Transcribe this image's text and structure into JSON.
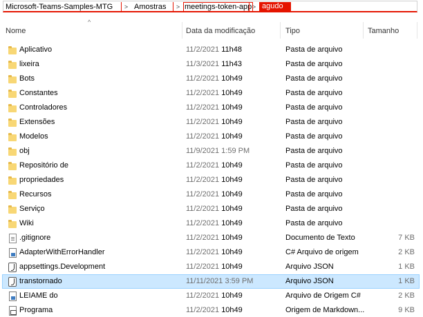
{
  "breadcrumb": {
    "items": [
      "Microsoft-Teams-Samples-MTG",
      "Amostras",
      "meetings-token-app"
    ],
    "active": "agudo",
    "separator": ">"
  },
  "columns": {
    "name": "Nome",
    "date": "Data da modificação",
    "type": "Tipo",
    "size": "Tamanho",
    "sort_indicator": "^"
  },
  "rows": [
    {
      "name": "Aplicativo",
      "date": "11/2/2021",
      "time": "11h48",
      "type": "Pasta de arquivo",
      "size": "",
      "icon": "folder-icon"
    },
    {
      "name": "lixeira",
      "date": "11/3/2021",
      "time": "11h43",
      "type": "Pasta de arquivo",
      "size": "",
      "icon": "folder-icon"
    },
    {
      "name": "Bots",
      "date": "11/2/2021",
      "time": "10h49",
      "type": "Pasta de arquivo",
      "size": "",
      "icon": "folder-icon"
    },
    {
      "name": "Constantes",
      "date": "11/2/2021",
      "time": "10h49",
      "type": "Pasta de arquivo",
      "size": "",
      "icon": "folder-icon"
    },
    {
      "name": "Controladores",
      "date": "11/2/2021",
      "time": "10h49",
      "type": "Pasta de arquivo",
      "size": "",
      "icon": "folder-icon"
    },
    {
      "name": "Extensões",
      "date": "11/2/2021",
      "time": "10h49",
      "type": "Pasta de arquivo",
      "size": "",
      "icon": "folder-icon"
    },
    {
      "name": "Modelos",
      "date": "11/2/2021",
      "time": "10h49",
      "type": "Pasta de arquivo",
      "size": "",
      "icon": "folder-icon"
    },
    {
      "name": "obj",
      "date": "11/9/2021 1:59 PM",
      "time": "",
      "type": "Pasta de arquivo",
      "size": "",
      "icon": "folder-icon"
    },
    {
      "name": "Repositório de",
      "date": "11/2/2021",
      "time": "10h49",
      "type": "Pasta de arquivo",
      "size": "",
      "icon": "folder-icon"
    },
    {
      "name": "propriedades",
      "date": "11/2/2021",
      "time": "10h49",
      "type": "Pasta de arquivo",
      "size": "",
      "icon": "folder-icon"
    },
    {
      "name": "Recursos",
      "date": "11/2/2021",
      "time": "10h49",
      "type": "Pasta de arquivo",
      "size": "",
      "icon": "folder-icon"
    },
    {
      "name": "Serviço",
      "date": "11/2/2021",
      "time": "10h49",
      "type": "Pasta de arquivo",
      "size": "",
      "icon": "folder-icon"
    },
    {
      "name": "Wiki",
      "date": "11/2/2021",
      "time": "10h49",
      "type": "Pasta de arquivo",
      "size": "",
      "icon": "folder-icon"
    },
    {
      "name": ".gitignore",
      "date": "11/2/2021",
      "time": "10h49",
      "type": "Documento de Texto",
      "size": "7 KB",
      "icon": "text-file-icon"
    },
    {
      "name": "AdapterWithErrorHandler",
      "date": "11/2/2021",
      "time": "10h49",
      "type": "C# Arquivo de origem",
      "size": "2 KB",
      "icon": "csharp-file-icon"
    },
    {
      "name": "appsettings.Development",
      "date": "11/2/2021",
      "time": "10h49",
      "type": "Arquivo JSON",
      "size": "1 KB",
      "icon": "json-file-icon"
    },
    {
      "name": "transtornado",
      "date": "11/11/2021 3:59 PM",
      "time": "",
      "type": "Arquivo JSON",
      "size": "1 KB",
      "icon": "json-file-icon",
      "selected": true
    },
    {
      "name": "LEIAME do",
      "date": "11/2/2021",
      "time": "10h49",
      "type": "Arquivo de Origem C#",
      "size": "2 KB",
      "icon": "csharp-file-icon"
    },
    {
      "name": "Programa",
      "date": "11/2/2021",
      "time": "10h49",
      "type": "Origem de Markdown...",
      "size": "9 KB",
      "icon": "markdown-file-icon"
    }
  ]
}
